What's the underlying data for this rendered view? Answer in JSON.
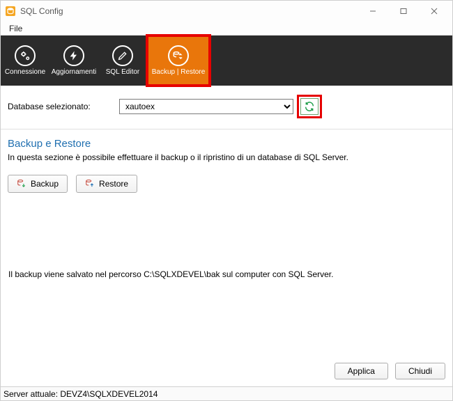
{
  "titlebar": {
    "title": "SQL Config"
  },
  "menubar": {
    "file": "File"
  },
  "toolbar": {
    "connessione": "Connessione",
    "aggiornamenti": "Aggiornamenti",
    "sql_editor": "SQL Editor",
    "backup_restore": "Backup | Restore"
  },
  "selector": {
    "label": "Database selezionato:",
    "value": "xautoex"
  },
  "section": {
    "title": "Backup e Restore",
    "desc": "In questa sezione è possibile effettuare il backup o il ripristino di un database di SQL Server.",
    "backup_btn": "Backup",
    "restore_btn": "Restore",
    "info": "Il backup viene salvato nel percorso C:\\SQLXDEVEL\\bak sul computer con SQL Server."
  },
  "footer": {
    "applica": "Applica",
    "chiudi": "Chiudi"
  },
  "statusbar": {
    "text": "Server attuale: DEVZ4\\SQLXDEVEL2014"
  }
}
